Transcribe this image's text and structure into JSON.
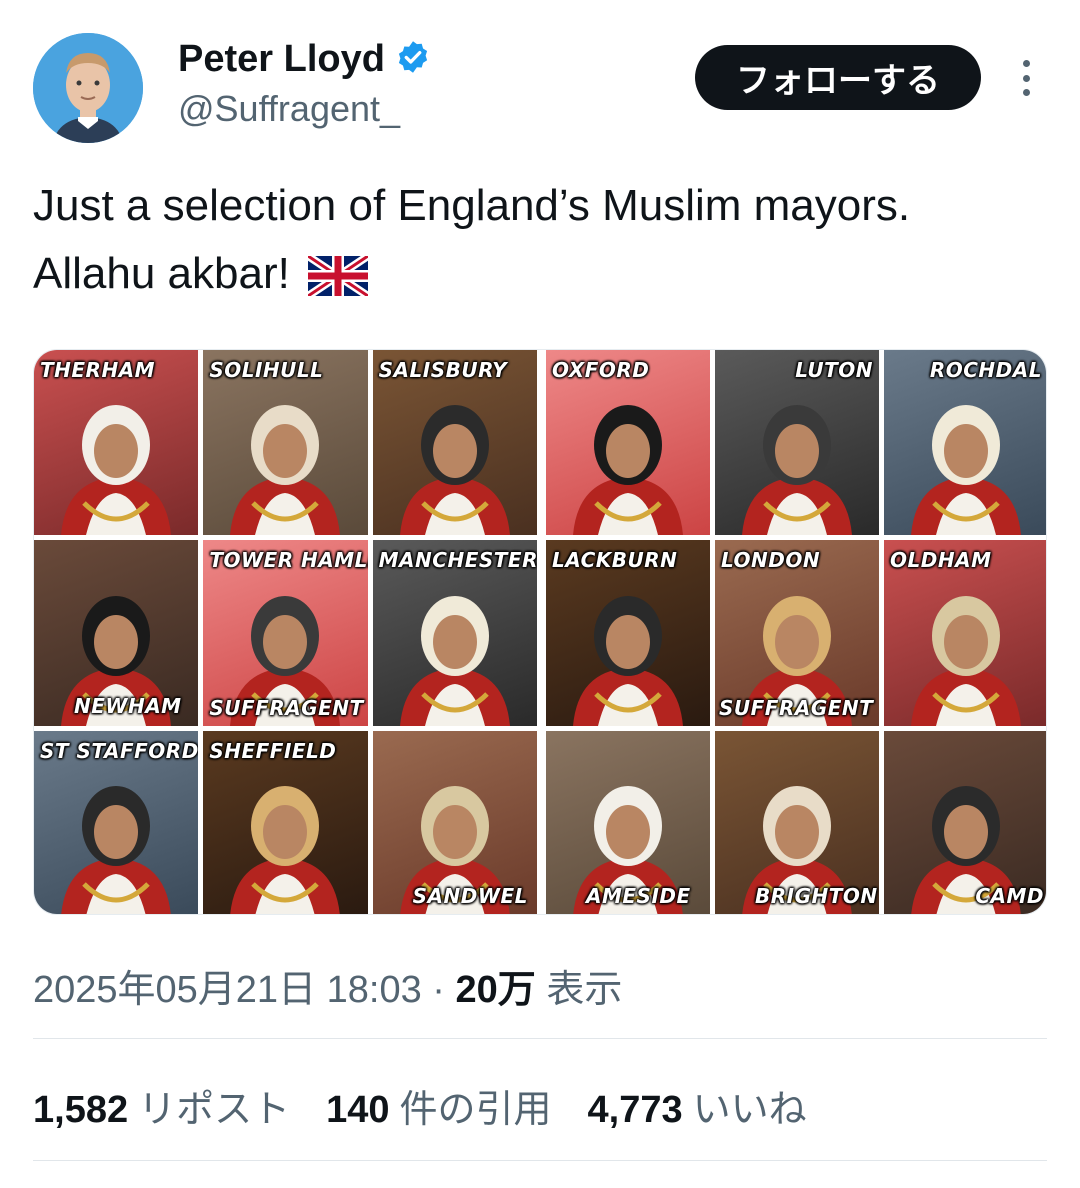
{
  "author": {
    "display_name": "Peter Lloyd",
    "handle": "@Suffragent_",
    "verified": true
  },
  "follow_button_label": "フォローする",
  "tweet": {
    "text": "Just a selection of England’s Muslim mayors. Allahu akbar!",
    "emoji": "flag-united-kingdom"
  },
  "media": {
    "left_panel": [
      {
        "label": "THERHAM",
        "pos": "top"
      },
      {
        "label": "SOLIHULL",
        "pos": "top"
      },
      {
        "label": "SALISBURY",
        "pos": "top"
      },
      {
        "label": "NEWHAM",
        "pos": "bottom"
      },
      {
        "label": "TOWER HAMLETS",
        "pos": "top",
        "watermark": "SUFFRAGENT"
      },
      {
        "label": "MANCHESTER C",
        "pos": "top"
      },
      {
        "label": "ST STAFFORD",
        "pos": "top"
      },
      {
        "label": "SHEFFIELD",
        "pos": "top"
      },
      {
        "label": "SANDWEL",
        "pos": "bottom"
      }
    ],
    "right_panel": [
      {
        "label": "OXFORD",
        "pos": "top"
      },
      {
        "label": "LUTON",
        "pos": "topr"
      },
      {
        "label": "ROCHDAL",
        "pos": "topr"
      },
      {
        "label": "LACKBURN",
        "pos": "top"
      },
      {
        "label": "LONDON",
        "pos": "top",
        "watermark": "SUFFRAGENT"
      },
      {
        "label": "OLDHAM",
        "pos": "top"
      },
      {
        "label": "AMESIDE",
        "pos": "bottom"
      },
      {
        "label": "BRIGHTON",
        "pos": "bottom"
      },
      {
        "label": "CAMD",
        "pos": "bottomr"
      }
    ]
  },
  "meta": {
    "timestamp": "2025年05月21日 18:03",
    "separator": "·",
    "views_count": "20万",
    "views_label": "表示"
  },
  "stats": {
    "reposts_count": "1,582",
    "reposts_label": "リポスト",
    "quotes_count": "140",
    "quotes_label": "件の引用",
    "likes_count": "4,773",
    "likes_label": "いいね"
  },
  "colors": {
    "text_primary": "#0f1419",
    "text_secondary": "#536471",
    "verified_blue": "#1d9bf0",
    "avatar_bg": "#4aa3df"
  }
}
